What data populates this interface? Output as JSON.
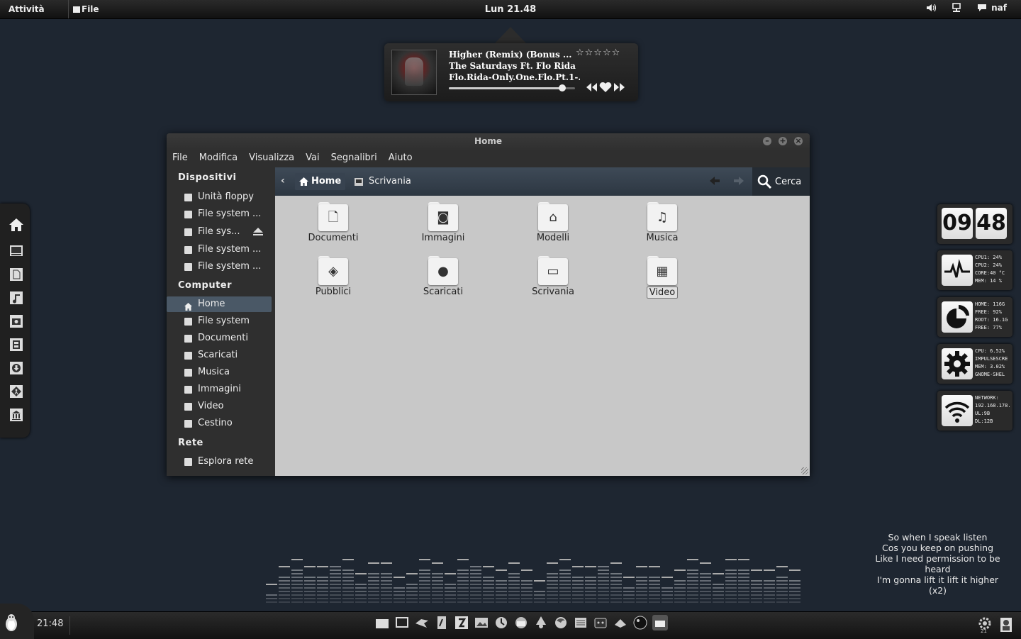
{
  "topbar": {
    "activities": "Attività",
    "app_menu": "File",
    "clock": "Lun 21.48",
    "user": "naf"
  },
  "music": {
    "title": "Higher (Remix) (Bonus ...",
    "artist": "The Saturdays Ft. Flo Rida",
    "album": "Flo.Rida-Only.One.Flo.Pt.1-...",
    "rating_stars": "☆☆☆☆☆",
    "progress": 0.9
  },
  "window": {
    "title": "Home",
    "menu": [
      "File",
      "Modifica",
      "Visualizza",
      "Vai",
      "Segnalibri",
      "Aiuto"
    ],
    "sidebar": {
      "devices_header": "Dispositivi",
      "devices": [
        "Unità floppy",
        "File system ...",
        "File sys...",
        "File system ...",
        "File system ..."
      ],
      "computer_header": "Computer",
      "computer": [
        "Home",
        "File system",
        "Documenti",
        "Scaricati",
        "Musica",
        "Immagini",
        "Video",
        "Cestino"
      ],
      "network_header": "Rete",
      "network": [
        "Esplora rete"
      ]
    },
    "path": {
      "home": "Home",
      "desktop": "Scrivania"
    },
    "search_label": "Cerca",
    "files": [
      {
        "name": "Documenti",
        "icon": "document-icon"
      },
      {
        "name": "Immagini",
        "icon": "camera-icon"
      },
      {
        "name": "Modelli",
        "icon": "templates-icon"
      },
      {
        "name": "Musica",
        "icon": "music-note-icon"
      },
      {
        "name": "Pubblici",
        "icon": "public-icon"
      },
      {
        "name": "Scaricati",
        "icon": "download-icon"
      },
      {
        "name": "Scrivania",
        "icon": "desktop-icon"
      },
      {
        "name": "Video",
        "icon": "film-icon",
        "selected": true
      }
    ]
  },
  "widgets": {
    "clock_hours": "09",
    "clock_minutes": "48",
    "cpu": [
      "CPU1: 24%",
      "CPU2: 24%",
      "CORE:40 °C",
      "MEM: 14 %"
    ],
    "disk": [
      "HOME: 116G",
      "FREE: 92%",
      "ROOT: 16.1G",
      "FREE: 77%"
    ],
    "process": [
      "CPU:  6.52%",
      "IMPULSESCRE",
      "MEM:  3.02%",
      "GNOME-SHEL"
    ],
    "network": [
      "NETWORK:",
      "192.168.178.",
      "UL:9B",
      "DL:12B"
    ]
  },
  "lyrics": [
    "So when I speak listen",
    "Cos you keep on pushing",
    "Like I need permission to be heard",
    "I'm gonna lift it lift it higher",
    "(x2)"
  ],
  "bottombar": {
    "time": "21:48",
    "badge": "21"
  },
  "colors": {
    "desktop": "#1e2631",
    "selection": "#4a5866",
    "content": "#c8c8c8"
  }
}
